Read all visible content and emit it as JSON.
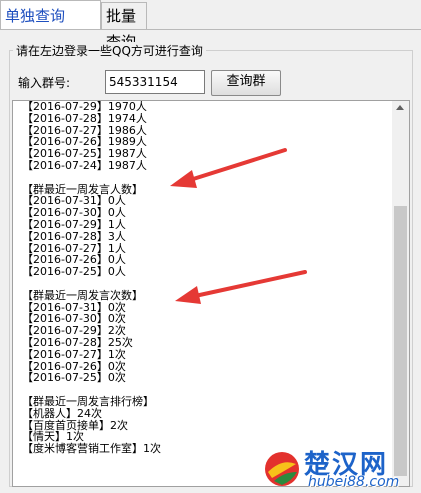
{
  "tabs": [
    {
      "label": "单独查询",
      "active": true
    },
    {
      "label": "批量查询",
      "active": false
    }
  ],
  "group": {
    "legend": "请在左边登录一些QQ方可进行查询"
  },
  "form": {
    "label": "输入群号:",
    "value": "545331154",
    "button": "查询群"
  },
  "results": {
    "lines": [
      "【2016-07-29】1970人",
      "【2016-07-28】1974人",
      "【2016-07-27】1986人",
      "【2016-07-26】1989人",
      "【2016-07-25】1987人",
      "【2016-07-24】1987人",
      "",
      "【群最近一周发言人数】",
      "【2016-07-31】0人",
      "【2016-07-30】0人",
      "【2016-07-29】1人",
      "【2016-07-28】3人",
      "【2016-07-27】1人",
      "【2016-07-26】0人",
      "【2016-07-25】0人",
      "",
      "【群最近一周发言次数】",
      "【2016-07-31】0次",
      "【2016-07-30】0次",
      "【2016-07-29】2次",
      "【2016-07-28】25次",
      "【2016-07-27】1次",
      "【2016-07-26】0次",
      "【2016-07-25】0次",
      "",
      "【群最近一周发言排行榜】",
      "【机器人】24次",
      "【百度首页接单】2次",
      "【情天】1次",
      "【度米博客营销工作室】1次"
    ]
  },
  "watermark": {
    "title": "楚汉网",
    "url": "hubei88.com"
  },
  "colors": {
    "arrow": "#e53935",
    "tab_active_text": "#1e4fbf",
    "watermark": "#1d63c9"
  }
}
